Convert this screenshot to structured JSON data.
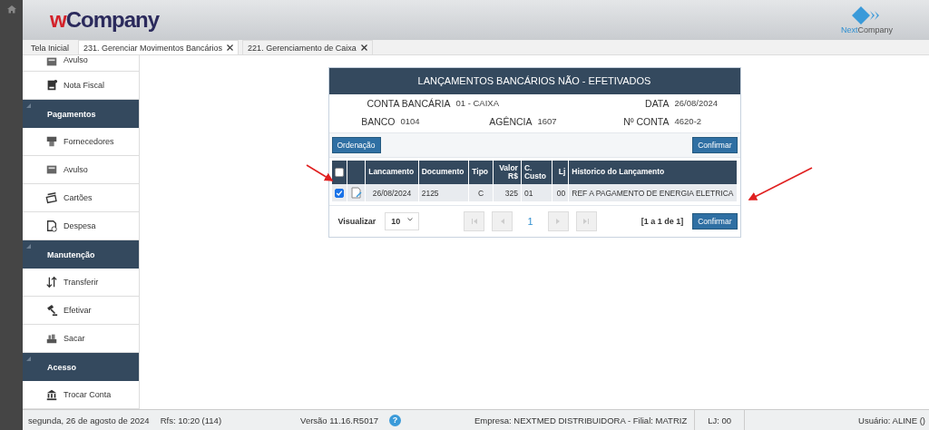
{
  "header": {
    "logo": {
      "accent": "w",
      "rest": "Company"
    },
    "brand": {
      "accent": "Next",
      "rest": "Company"
    }
  },
  "tabs": [
    {
      "label": "Tela Inicial",
      "selected": false,
      "closable": false
    },
    {
      "label": "231. Gerenciar Movimentos Bancários",
      "selected": true,
      "closable": true
    },
    {
      "label": "221. Gerenciamento de Caixa",
      "selected": false,
      "closable": true
    }
  ],
  "sidebar": {
    "items": [
      {
        "kind": "item",
        "label": "Avulso",
        "partial": true
      },
      {
        "kind": "item",
        "label": "Nota Fiscal"
      },
      {
        "kind": "section",
        "label": "Pagamentos",
        "expanded": true,
        "children": [
          {
            "kind": "item",
            "label": "Fornecedores"
          },
          {
            "kind": "item",
            "label": "Avulso"
          },
          {
            "kind": "item",
            "label": "Cartões"
          },
          {
            "kind": "item",
            "label": "Despesa"
          }
        ]
      },
      {
        "kind": "section",
        "label": "Manutenção",
        "expanded": true,
        "children": [
          {
            "kind": "item",
            "label": "Transferir"
          },
          {
            "kind": "item",
            "label": "Efetivar"
          },
          {
            "kind": "item",
            "label": "Sacar"
          }
        ]
      },
      {
        "kind": "section",
        "label": "Acesso",
        "expanded": true,
        "children": [
          {
            "kind": "item",
            "label": "Trocar Conta"
          }
        ]
      }
    ]
  },
  "panel": {
    "title": "LANÇAMENTOS BANCÁRIOS NÃO - EFETIVADOS",
    "info": [
      [
        {
          "label": "CONTA BANCÁRIA",
          "value": "01 - CAIXA"
        },
        {
          "label": "DATA",
          "value": "26/08/2024"
        }
      ],
      [
        {
          "label": "BANCO",
          "value": "0104"
        },
        {
          "label": "AGÊNCIA",
          "value": "1607"
        },
        {
          "label": "Nº CONTA",
          "value": "4620-2"
        }
      ]
    ],
    "toolbar": {
      "left": "Ordenação",
      "right": "Confirmar"
    },
    "table": {
      "select_all": false,
      "columns": [
        "Lancamento",
        "Documento",
        "Tipo",
        "Valor R$",
        "C. Custo",
        "Lj",
        "Historico do Lançamento"
      ],
      "rows": [
        {
          "checked": true,
          "cells": [
            "26/08/2024",
            "2125",
            "C",
            "325",
            "01",
            "00",
            "REF A PAGAMENTO DE ENERGIA ELETRICA"
          ]
        }
      ]
    },
    "footer": {
      "label": "Visualizar",
      "page_size": "10",
      "page": "1",
      "summary": "[1 a 1 de 1]",
      "button": "Confirmar"
    }
  },
  "status_bar": {
    "date": "segunda, 26 de agosto de 2024",
    "rfs": "Rfs: 10:20 (114)",
    "version": "Versão 11.16.R5017",
    "help": "?",
    "company": "Empresa: NEXTMED DISTRIBUIDORA - Filial: MATRIZ",
    "store": "LJ: 00",
    "user": "Usuário: ALINE ()"
  }
}
